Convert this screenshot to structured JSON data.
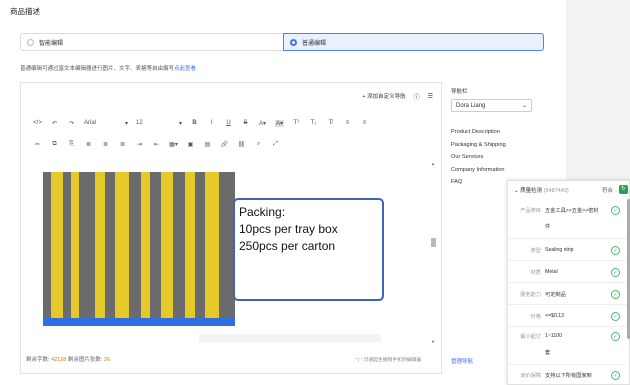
{
  "section_title": "商品描述",
  "modes": {
    "smart": "智能编辑",
    "normal": "普通编辑",
    "selected": "normal"
  },
  "description": {
    "text": "普通编辑可通过富文本编辑器进行图片、文字、表格等自由撰写",
    "link": "点此查看"
  },
  "editor": {
    "add_nav": "+ 添加自定义导航",
    "font_family": "Arial",
    "font_size": "12",
    "content_text": "Packing:\n10pcs per tray box\n250pcs per carton",
    "char_count_label": "剩余字数:",
    "char_count": "42128",
    "img_count_label": "剩余图片张数:",
    "img_count": "26",
    "hint": "\" | \" 可避起生撤销手机到编辑器"
  },
  "nav": {
    "title": "导航栏",
    "selected": "Dora Liang",
    "items": [
      "Product Description",
      "Packaging & Shipping",
      "Our Services",
      "Company Information",
      "FAQ"
    ],
    "manage": "管理导航"
  },
  "check_panel": {
    "title": "质量检测",
    "count": "(5487443)",
    "status": "符合",
    "rows": [
      {
        "label": "产品类目",
        "value": "五金工具>>五金>>密封",
        "cont": "件"
      },
      {
        "label": "类型",
        "value": "Sealing strip"
      },
      {
        "label": "材质",
        "value": "Metal"
      },
      {
        "label": "服务能力",
        "value": "可定制品"
      },
      {
        "label": "价格",
        "value": "<=$0.13"
      },
      {
        "label": "最小起订",
        "value": "1~1100",
        "cont": "套"
      },
      {
        "label": "询价保障",
        "value": "支持以下所有国家到"
      }
    ]
  },
  "colors": {
    "accent": "#3c6ef6",
    "success": "#22a04b",
    "warning": "#e07b1a"
  }
}
